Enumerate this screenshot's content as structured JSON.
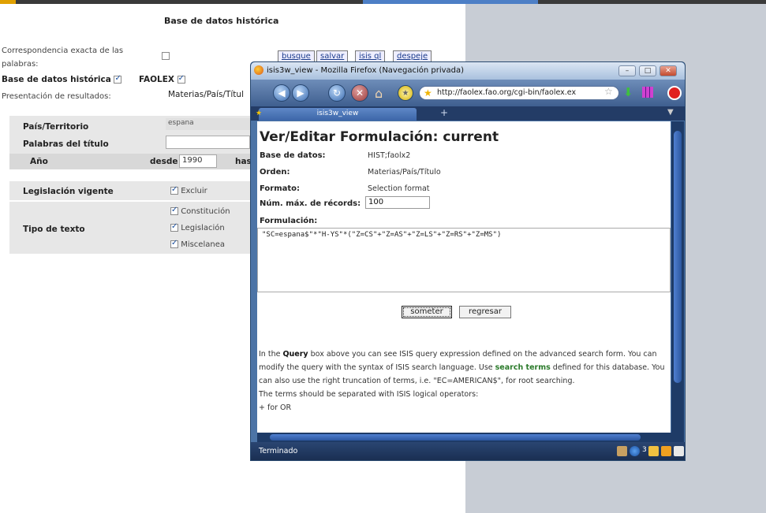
{
  "bg_page": {
    "header": "Base de datos histórica",
    "exact_match_label": "Correspondencia exacta de las palabras:",
    "buttons": {
      "busque": "busque",
      "salvar": "salvar",
      "isis_ql": "isis ql",
      "despeje": "despeje"
    },
    "db_hist_label": "Base de datos histórica",
    "faolex_label": "FAOLEX",
    "presentation_label": "Presentación de resultados:",
    "presentation_value": "Materias/País/Títul",
    "pais_label": "País/Territorio",
    "pais_value": "espana",
    "palabras_label": "Palabras del título",
    "anio_label": "Año",
    "desde_label": "desde",
    "desde_value": "1990",
    "hasta_label": "has",
    "legislacion_label": "Legislación vigente",
    "excluir_label": "Excluir",
    "tipo_label": "Tipo de texto",
    "tipo_options": [
      "Constitución",
      "Legislación",
      "Miscelanea"
    ]
  },
  "firefox": {
    "title": "isis3w_view - Mozilla Firefox (Navegación privada)",
    "url": "http://faolex.fao.org/cgi-bin/faolex.ex",
    "tab_label": "isis3w_view",
    "status": "Terminado",
    "status_count": "3"
  },
  "form": {
    "heading": "Ver/Editar Formulación: current",
    "base_k": "Base de datos:",
    "base_v": "HIST;faolx2",
    "orden_k": "Orden:",
    "orden_v": "Materias/País/Título",
    "formato_k": "Formato:",
    "formato_v": "Selection format",
    "num_k": "Núm. máx. de récords:",
    "num_v": "100",
    "formulacion_k": "Formulación:",
    "query": "\"SC=espana$\"*\"H-YS\"*(\"Z=CS\"+\"Z=AS\"+\"Z=LS\"+\"Z=RS\"+\"Z=MS\")",
    "submit": "someter",
    "back": "regresar"
  },
  "help": {
    "p1a": "In the ",
    "p1b": "Query",
    "p1c": " box above you can see ISIS query expression defined on the advanced search form. You can modify the query with the syntax of ISIS search language. Use ",
    "p1d": "search terms",
    "p1e": " defined for this database. You can also use the right truncation of terms, i.e. \"EC=AMERICAN$\", for root searching.",
    "p2": "The terms should be separated with ISIS logical operators:",
    "p3": "+ for OR"
  },
  "colors": {
    "accent": "#4c74a6",
    "link": "#1a3a8a",
    "green": "#2a7a2a"
  }
}
